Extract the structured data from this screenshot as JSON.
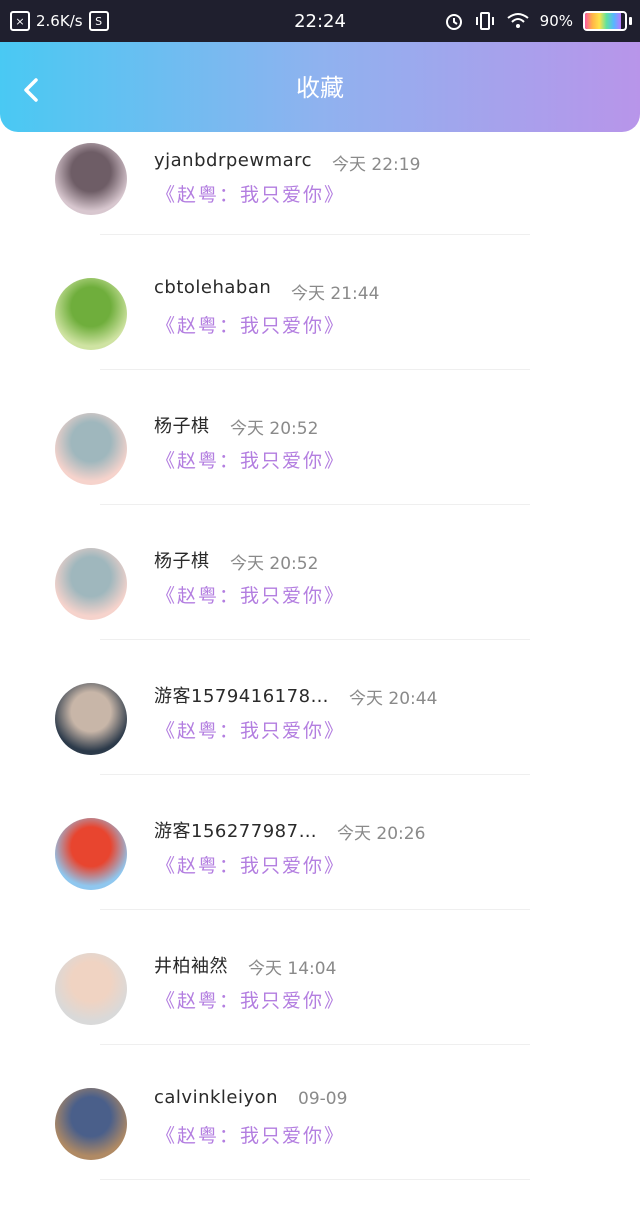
{
  "status_bar": {
    "net_speed": "2.6K/s",
    "time": "22:24",
    "battery_text": "90%",
    "battery_level": 0.9
  },
  "header": {
    "title": "收藏",
    "back_icon": "chevron-left-icon"
  },
  "favorites": [
    {
      "user": "yjanbdrpewmarc",
      "time": "今天 22:19",
      "song": "《赵粤：我只爱你》",
      "avatar_colors": [
        "#d8c7cf",
        "#6e5d66"
      ]
    },
    {
      "user": "cbtolehaban",
      "time": "今天 21:44",
      "song": "《赵粤：我只爱你》",
      "avatar_colors": [
        "#cfe3a2",
        "#6fae3c"
      ]
    },
    {
      "user": "杨子棋",
      "time": "今天 20:52",
      "song": "《赵粤：我只爱你》",
      "avatar_colors": [
        "#f6d3cc",
        "#9fb7bd"
      ]
    },
    {
      "user": "杨子棋",
      "time": "今天 20:52",
      "song": "《赵粤：我只爱你》",
      "avatar_colors": [
        "#f6d3cc",
        "#9fb7bd"
      ]
    },
    {
      "user": "游客1579416178…",
      "time": "今天 20:44",
      "song": "《赵粤：我只爱你》",
      "avatar_colors": [
        "#2c3a4a",
        "#c8b6a8"
      ]
    },
    {
      "user": "游客156277987…",
      "time": "今天 20:26",
      "song": "《赵粤：我只爱你》",
      "avatar_colors": [
        "#8fc7ef",
        "#e8452f"
      ]
    },
    {
      "user": "井柏袖然",
      "time": "今天 14:04",
      "song": "《赵粤：我只爱你》",
      "avatar_colors": [
        "#d9d9d9",
        "#f0d3c2"
      ]
    },
    {
      "user": "calvinkleiyon",
      "time": "09-09",
      "song": "《赵粤：我只爱你》",
      "avatar_colors": [
        "#b08a64",
        "#4a5f8a"
      ]
    }
  ]
}
